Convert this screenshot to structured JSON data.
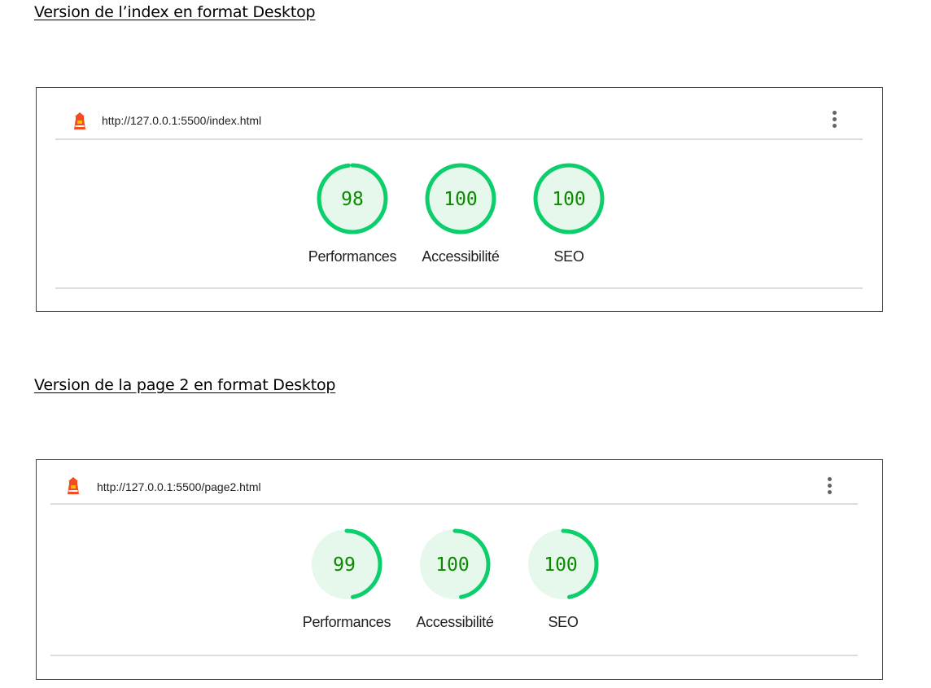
{
  "reports": [
    {
      "heading": "Version de l’index en format Desktop",
      "url": "http://127.0.0.1:5500/index.html",
      "gauges": [
        {
          "score": 98,
          "value_text": "98",
          "label": "Performances",
          "ring": "full"
        },
        {
          "score": 100,
          "value_text": "100",
          "label": "Accessibilité",
          "ring": "full"
        },
        {
          "score": 100,
          "value_text": "100",
          "label": "SEO",
          "ring": "full"
        }
      ]
    },
    {
      "heading": "Version de la page 2 en format Desktop",
      "url": "http://127.0.0.1:5500/page2.html",
      "gauges": [
        {
          "score": 99,
          "value_text": "99",
          "label": "Performances",
          "ring": "partial"
        },
        {
          "score": 100,
          "value_text": "100",
          "label": "Accessibilité",
          "ring": "partial"
        },
        {
          "score": 100,
          "value_text": "100",
          "label": "SEO",
          "ring": "partial"
        }
      ]
    }
  ],
  "colors": {
    "pass_ring": "#0cce6b",
    "pass_fill": "#e6f7ec",
    "pass_text": "#0b8a00",
    "lighthouse_icon": "#f44b21"
  },
  "icons": {
    "lighthouse": "lighthouse-icon",
    "menu": "more-vert-icon"
  }
}
